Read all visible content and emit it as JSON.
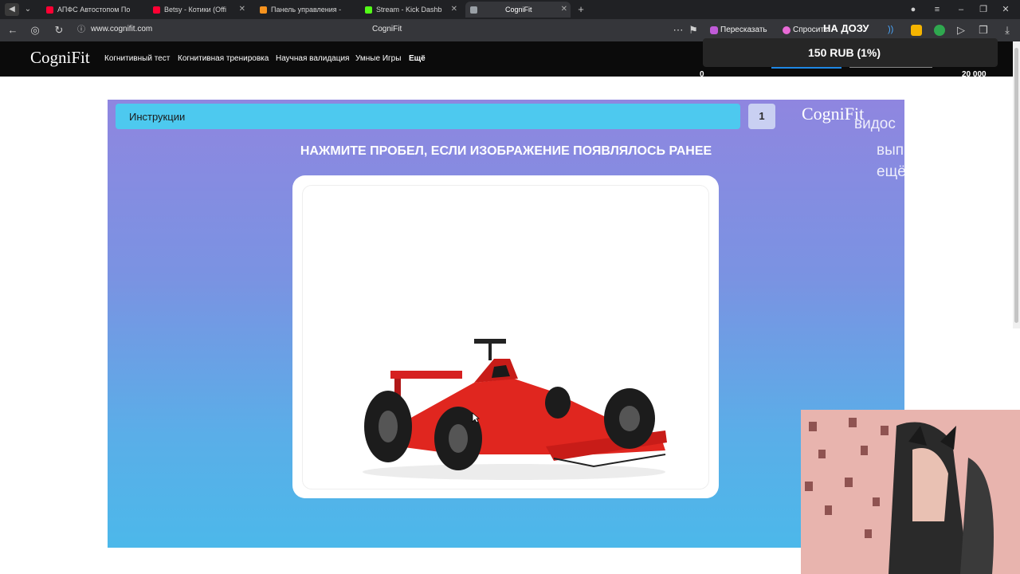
{
  "browser": {
    "tabs": [
      {
        "title": "АПФС Автостопом По Ф",
        "icon": "youtube-icon",
        "color": "#ff0033"
      },
      {
        "title": "Betsy - Котики (Offi",
        "icon": "youtube-icon",
        "color": "#ff0033"
      },
      {
        "title": "Панель управления - Don",
        "icon": "donationalerts-icon",
        "color": "#f7931e"
      },
      {
        "title": "Stream - Kick Dashb",
        "icon": "kick-icon",
        "color": "#53fc18"
      },
      {
        "title": "CogniFit",
        "icon": "cognifit-icon",
        "color": "#9aa0a6",
        "active": true
      }
    ],
    "url": "www.cognifit.com",
    "page_title": "CogniFit",
    "toolbar": {
      "retell_label": "Пересказать",
      "ask_label": "Спросить"
    }
  },
  "site": {
    "logo": "CogniFit",
    "nav": [
      "Когнитивный тест",
      "Когнитивная тренировка",
      "Научная валидация",
      "Умные Игры",
      "Ещё"
    ]
  },
  "overlay": {
    "donation_title": "НА ДОЗУ",
    "donation_amount": "150 RUB (1%)",
    "min": "0",
    "max": "20 000",
    "ghost_1": "видос",
    "ghost_2": "вып",
    "ghost_3": "ещё"
  },
  "game": {
    "instructions_label": "Инструкции",
    "counter": "1",
    "logo": "CogniFit",
    "task": "НАЖМИТЕ ПРОБЕЛ, ЕСЛИ ИЗОБРАЖЕНИЕ ПОЯВЛЯЛОСЬ РАНЕЕ",
    "image_subject": "formula-1-car",
    "accent_color": "#4dc9ef"
  }
}
